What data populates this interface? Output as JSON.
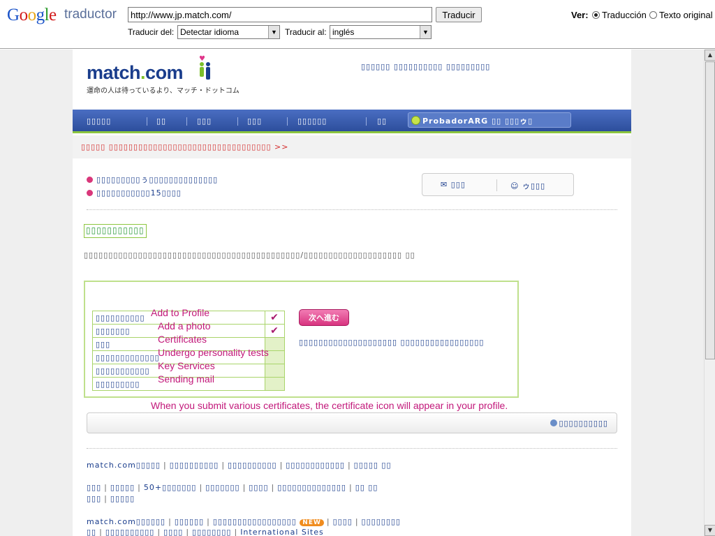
{
  "toolbar": {
    "logo_google": [
      "G",
      "o",
      "o",
      "g",
      "l",
      "e"
    ],
    "logo_product": "traductor",
    "url_value": "http://www.jp.match.com/",
    "translate_button": "Traducir",
    "from_label": "Traducir del:",
    "from_value": "Detectar idioma",
    "to_label": "Traducir al:",
    "to_value": "inglés",
    "view_label": "Ver:",
    "view_translation": "Traducción",
    "view_original": "Texto original"
  },
  "site": {
    "logo_text": "match",
    "logo_dot": ".",
    "logo_tld": "com",
    "tagline": "運命の人は待っているより、マッチ・ドットコム",
    "top_right": "▯▯▯▯▯▯ ▯▯▯▯▯▯▯▯▯▯ ▯▯▯▯▯▯▯▯▯",
    "nav": [
      "▯▯▯▯▯",
      "▯▯",
      "▯▯▯",
      "▯▯▯",
      "▯▯▯▯▯▯",
      "▯▯"
    ],
    "user_label": "ProbadorARG",
    "user_suffix": "▯▯ ▯▯▯ゥ▯",
    "promo": "▯▯▯▯▯  ▯▯▯▯▯▯▯▯▯▯▯▯▯▯▯▯▯▯▯▯▯▯▯▯▯▯▯▯▯▯▯▯▯ >>",
    "bullet1": "▯▯▯▯▯▯▯▯▯ぅ▯▯▯▯▯▯▯▯▯▯▯▯▯▯",
    "bullet2": "▯▯▯▯▯▯▯▯▯▯▯15▯▯▯▯",
    "mail_label": "▯▯▯",
    "smile_label": "ゥ▯▯▯",
    "section_title": "▯▯▯▯▯▯▯▯▯▯▯",
    "intro": "▯▯▯▯▯▯▯▯▯▯▯▯▯▯▯▯▯▯▯▯▯▯▯▯▯▯▯▯▯▯▯▯▯▯▯▯▯▯▯▯▯▯▯▯/▯▯▯▯▯▯▯▯▯▯▯▯▯▯▯▯▯▯▯▯ ▯▯",
    "checklist": [
      {
        "label": "▯▯▯▯▯▯▯▯▯▯",
        "checked": "✔"
      },
      {
        "label": "▯▯▯▯▯▯▯",
        "checked": "✔"
      },
      {
        "label": "▯▯▯",
        "checked": ""
      },
      {
        "label": "▯▯▯▯▯▯▯▯▯▯▯▯▯",
        "checked": ""
      },
      {
        "label": "▯▯▯▯▯▯▯▯▯▯▯",
        "checked": ""
      },
      {
        "label": "▯▯▯▯▯▯▯▯▯",
        "checked": ""
      }
    ],
    "next_button": "次へ進む",
    "panel_text": "▯▯▯▯▯▯▯▯▯▯▯▯▯▯▯▯▯▯▯▯ ▯▯▯▯▯▯▯▯▯▯▯▯▯▯▯▯▯",
    "overlay_labels": [
      "Add to Profile",
      "Add a photo",
      "Certificates",
      "Undergo personality tests",
      "Key Services",
      "Sending mail"
    ],
    "overlay_note": "When you submit various certificates, the certificate icon will appear in your profile.",
    "status_text": "▯▯▯▯▯▯▯▯▯▯",
    "footer": {
      "line1": [
        "match.com▯▯▯▯▯",
        "▯▯▯▯▯▯▯▯▯▯",
        "▯▯▯▯▯▯▯▯▯▯",
        "▯▯▯▯▯▯▯▯▯▯▯▯",
        "▯▯▯▯▯ ▯▯"
      ],
      "line2": [
        "▯▯▯",
        "▯▯▯▯▯",
        "50+▯▯▯▯▯▯▯",
        "▯▯▯▯▯▯▯",
        "▯▯▯▯",
        "▯▯▯▯▯▯▯▯▯▯▯▯▯▯",
        "▯▯ ▯▯"
      ],
      "line3": [
        "▯▯▯",
        "▯▯▯▯▯"
      ],
      "line4": [
        "match.com▯▯▯▯▯▯",
        "▯▯▯▯▯▯",
        "▯▯▯▯▯▯▯▯▯▯▯▯▯▯▯▯▯"
      ],
      "new_badge": "NEW",
      "line4b": [
        "▯▯▯▯",
        "▯▯▯▯▯▯▯▯"
      ],
      "line5": [
        "▯▯",
        "▯▯▯▯▯▯▯▯▯▯",
        "▯▯▯▯",
        "▯▯▯▯▯▯▯▯",
        "International Sites"
      ]
    }
  },
  "colors": {
    "nav_blue": "#2d4e9c",
    "accent_green": "#8cc63f",
    "accent_pink": "#c2187a",
    "link_blue": "#1a3d8c"
  }
}
